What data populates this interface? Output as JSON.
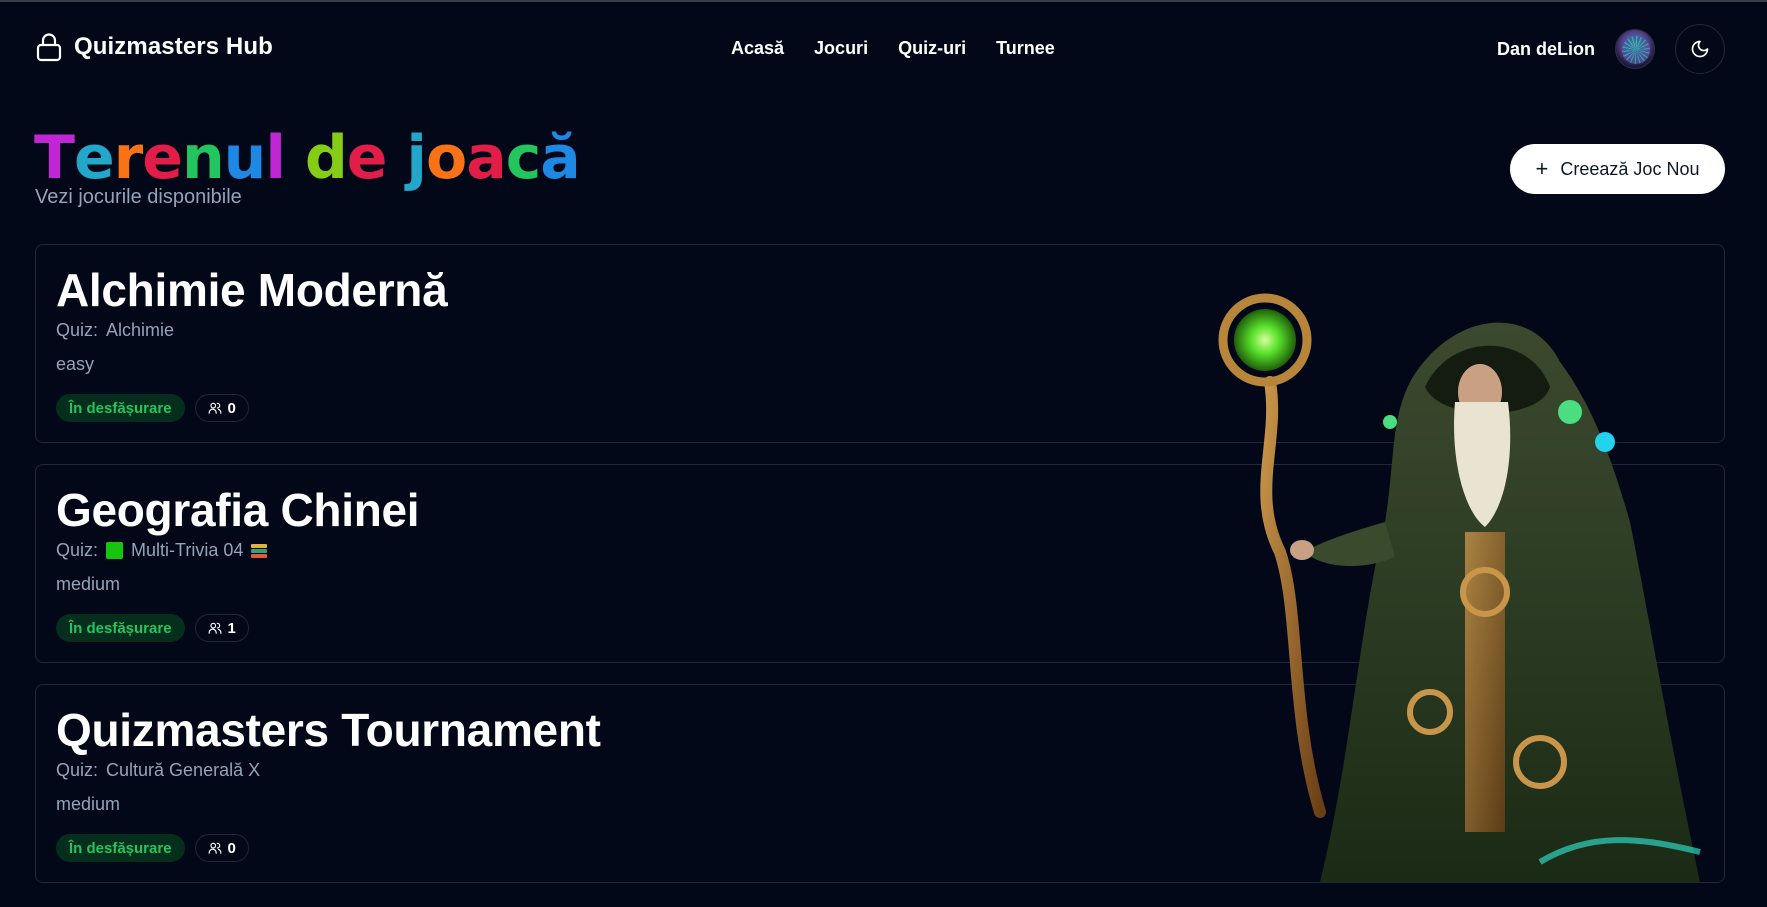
{
  "header": {
    "brand": "Quizmasters Hub",
    "nav": [
      "Acasă",
      "Jocuri",
      "Quiz-uri",
      "Turnee"
    ],
    "user_name": "Dan deLion"
  },
  "page": {
    "title_letters": [
      {
        "ch": "T",
        "color": "#c026d3"
      },
      {
        "ch": "e",
        "color": "#22a6c9"
      },
      {
        "ch": "r",
        "color": "#f97316"
      },
      {
        "ch": "e",
        "color": "#e11d48"
      },
      {
        "ch": "n",
        "color": "#22c55e"
      },
      {
        "ch": "u",
        "color": "#1e88e5"
      },
      {
        "ch": "l",
        "color": "#c026d3"
      },
      {
        "ch": " ",
        "color": "#ffffff"
      },
      {
        "ch": "d",
        "color": "#84cc16"
      },
      {
        "ch": "e",
        "color": "#e11d48"
      },
      {
        "ch": " ",
        "color": "#ffffff"
      },
      {
        "ch": "j",
        "color": "#22a6c9"
      },
      {
        "ch": "o",
        "color": "#f97316"
      },
      {
        "ch": "a",
        "color": "#e11d48"
      },
      {
        "ch": "c",
        "color": "#22c55e"
      },
      {
        "ch": "ă",
        "color": "#1e88e5"
      }
    ],
    "subtitle": "Vezi jocurile disponibile",
    "create_button": "Creează Joc Nou"
  },
  "games": [
    {
      "title": "Alchimie Modernă",
      "quiz_prefix": "Quiz:",
      "quiz_name": "Alchimie",
      "icons": false,
      "difficulty": "easy",
      "status": "În desfășurare",
      "players": "0"
    },
    {
      "title": "Geografia Chinei",
      "quiz_prefix": "Quiz:",
      "quiz_name": "Multi-Trivia 04",
      "icons": true,
      "difficulty": "medium",
      "status": "În desfășurare",
      "players": "1"
    },
    {
      "title": "Quizmasters Tournament",
      "quiz_prefix": "Quiz:",
      "quiz_name": "Cultură Generală X",
      "icons": false,
      "difficulty": "medium",
      "status": "În desfășurare",
      "players": "0"
    }
  ],
  "icons": {
    "brand": "lock-icon",
    "theme_toggle": "moon-icon",
    "create": "plus-icon",
    "players": "users-icon"
  },
  "colors": {
    "background": "#020817",
    "status_text": "#22c55e",
    "status_bg": "#052e1c",
    "muted": "#94a3b8"
  }
}
